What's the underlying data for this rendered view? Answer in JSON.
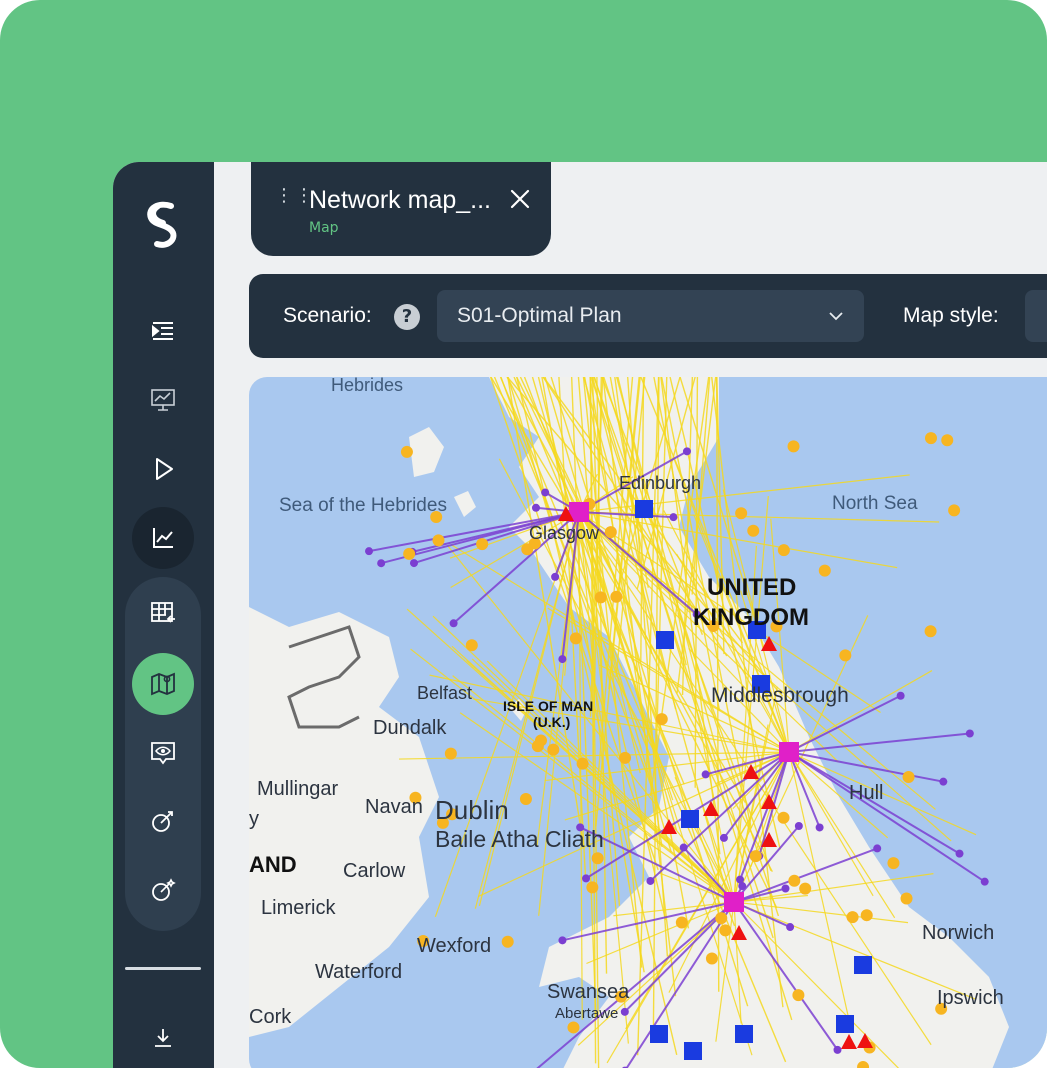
{
  "tab": {
    "title": "Network map_...",
    "subtitle": "Map"
  },
  "toolbar": {
    "scenario_label": "Scenario:",
    "help_icon": "?",
    "scenario_value": "S01-Optimal Plan",
    "map_style_label": "Map style:"
  },
  "sidebar": {
    "items": [
      "menu-indent-icon",
      "presentation-chart-icon",
      "play-icon",
      "line-chart-icon",
      "table-import-icon",
      "map-icon",
      "eye-bubble-icon",
      "target-arrow-icon",
      "target-sparkle-icon",
      "download-icon"
    ],
    "active_item": "map-icon"
  },
  "colors": {
    "frame_bg": "#62c484",
    "sidebar": "#23313f",
    "accent": "#62c484",
    "flow_yellow": "#f4d81f",
    "flow_purple": "#7b3fd1",
    "warehouse_blue": "#1a3be0",
    "hub_magenta": "#e020c8",
    "alert_red": "#ee1111",
    "customer_orange": "#f7b521",
    "sea": "#a9c8ef",
    "land": "#f1f1ee"
  },
  "map": {
    "places": [
      "Hebrides",
      "Sea of the Hebrides",
      "Edinburgh",
      "Glasgow",
      "North Sea",
      "UNITED",
      "KINGDOM",
      "Belfast",
      "ISLE OF MAN",
      "(U.K.)",
      "Dundalk",
      "Middlesbrough",
      "Mullingar",
      "Navan",
      "Dublin",
      "Baile Atha Cliath",
      "Hull",
      "AND",
      "Carlow",
      "Limerick",
      "Norwich",
      "Wexford",
      "Waterford",
      "Swansea",
      "Abertawe",
      "Ipswich",
      "Cork",
      "y"
    ]
  }
}
